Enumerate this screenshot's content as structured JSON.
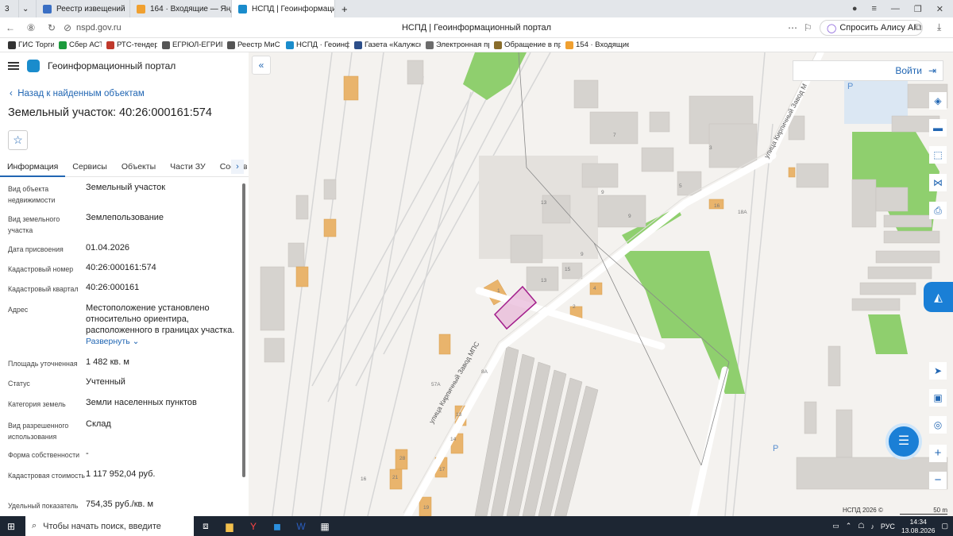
{
  "browser": {
    "tab_counter": "3",
    "tabs": [
      {
        "title": "Реестр извещений",
        "color": "#3a6fc4"
      },
      {
        "title": "164 · Входящие — Яндекс",
        "color": "#f0a030"
      },
      {
        "title": "НСПД | Геоинформаци...",
        "color": "#1a8ccc"
      }
    ],
    "url": "nspd.gov.ru",
    "page_title": "НСПД | Геоинформационный портал",
    "alice_label": "Спросить Алису AI",
    "bookmarks": [
      {
        "title": "ГИС Торги·",
        "color": "#333"
      },
      {
        "title": "Сбер АСТ·",
        "color": "#1b9a3c"
      },
      {
        "title": "РТС-тендер·",
        "color": "#c0392b"
      },
      {
        "title": "ЕГРЮЛ-ЕГРИП·",
        "color": "#555"
      },
      {
        "title": "Реестр МиС",
        "color": "#555"
      },
      {
        "title": "НСПД · Геоинфор",
        "color": "#1a8ccc"
      },
      {
        "title": "Газета «Калужск",
        "color": "#2d4f8a"
      },
      {
        "title": "Электронная при",
        "color": "#6c6c6c"
      },
      {
        "title": "Обращение в пра",
        "color": "#8a6d2b"
      },
      {
        "title": "154 · Входящие —",
        "color": "#f0a030"
      }
    ]
  },
  "portal": {
    "name": "Геоинформационный портал",
    "back_label": "Назад к найденным объектам",
    "object_title": "Земельный участок: 40:26:000161:574",
    "tabs": [
      "Информация",
      "Сервисы",
      "Объекты",
      "Части ЗУ",
      "Состав"
    ],
    "props": [
      {
        "k": "Вид объекта недвижимости",
        "v": "Земельный участок"
      },
      {
        "k": "Вид земельного участка",
        "v": "Землепользование"
      },
      {
        "k": "Дата присвоения",
        "v": "01.04.2026"
      },
      {
        "k": "Кадастровый номер",
        "v": "40:26:000161:574"
      },
      {
        "k": "Кадастровый квартал",
        "v": "40:26:000161"
      },
      {
        "k": "Адрес",
        "v": "Местоположение установлено относительно ориентира, расположенного в границах участка."
      },
      {
        "k": "Площадь уточненная",
        "v": "1 482 кв. м"
      },
      {
        "k": "Статус",
        "v": "Учтенный"
      },
      {
        "k": "Категория земель",
        "v": "Земли населенных пунктов"
      },
      {
        "k": "Вид разрешенного использования",
        "v": "Склад"
      },
      {
        "k": "Форма собственности",
        "v": "-"
      },
      {
        "k": "Кадастровая стоимость",
        "v": "1 117 952,04 руб."
      },
      {
        "k": "Удельный показатель",
        "v": "754,35 руб./кв. м"
      }
    ],
    "expand_label": "Развернуть"
  },
  "map": {
    "login_label": "Войти",
    "street_1": "улица Кирпичный Завод МПС",
    "street_2": "улица Кирпичный Завод М",
    "attribution": "НСПД 2026 ©",
    "scale": "50 m",
    "labels": [
      "7",
      "3",
      "9",
      "9",
      "5",
      "16",
      "18А",
      "13",
      "15",
      "9",
      "13",
      "4",
      "2",
      "1",
      "8А",
      "13",
      "14",
      "17",
      "16",
      "21",
      "28",
      "19",
      "57А"
    ]
  },
  "taskbar": {
    "search_placeholder": "Чтобы начать поиск, введите",
    "lang": "РУС",
    "time": "14:34",
    "date": "13.08.2026"
  }
}
